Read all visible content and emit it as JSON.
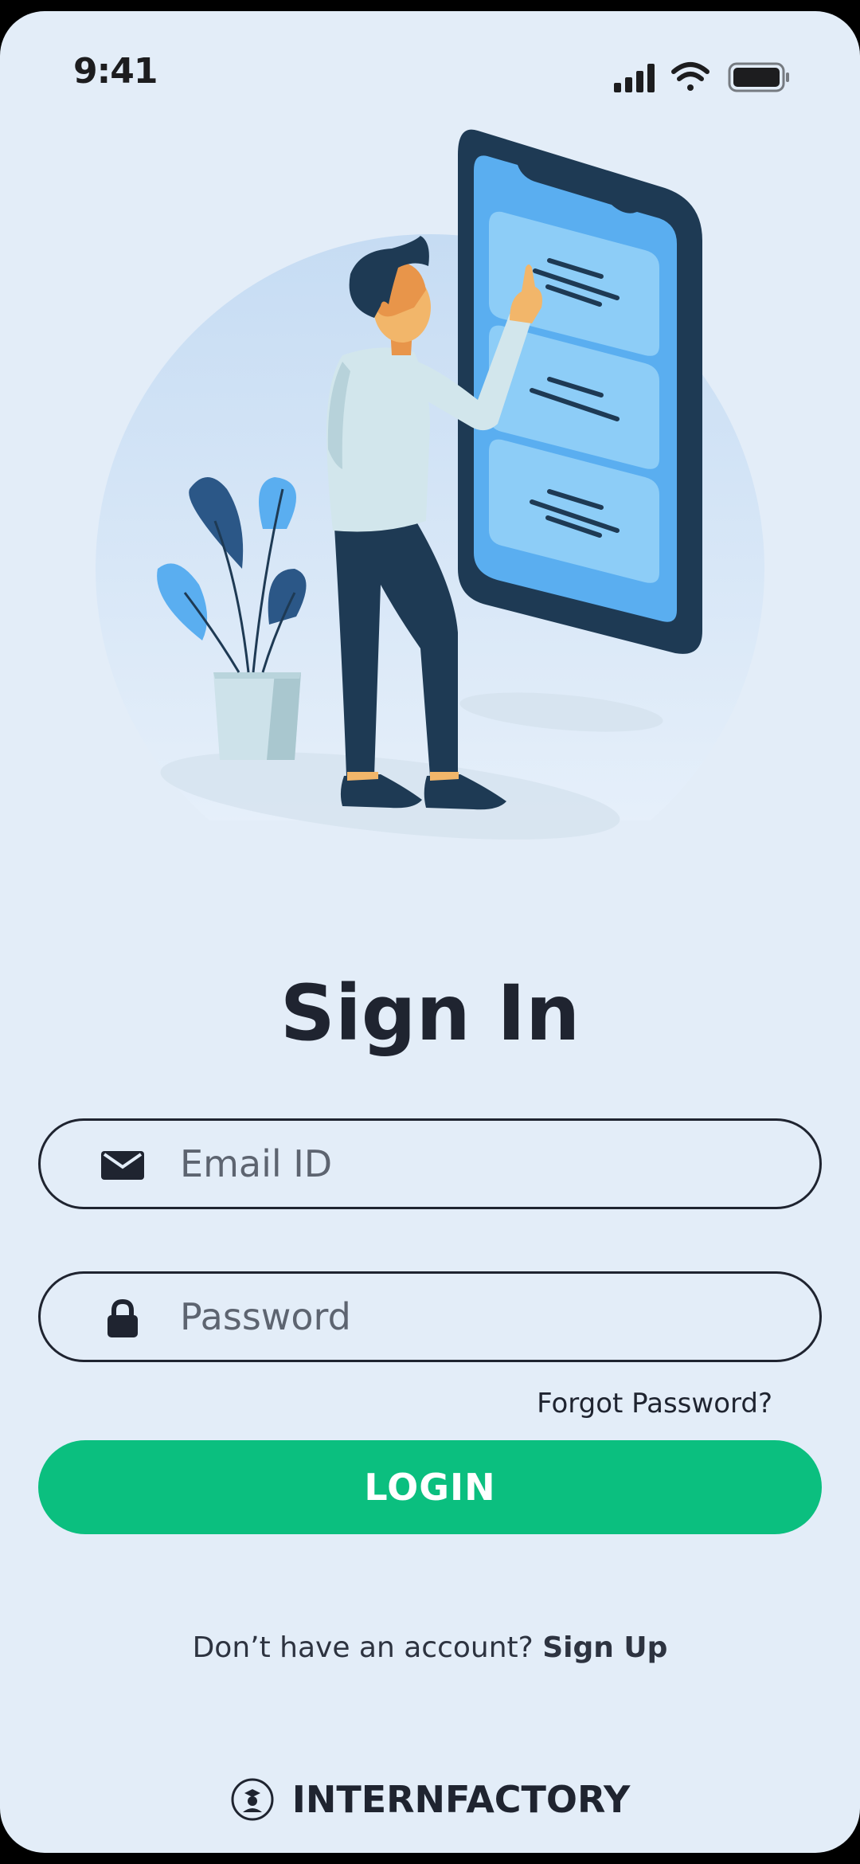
{
  "status_bar": {
    "time": "9:41",
    "icons": [
      "signal-icon",
      "wifi-icon",
      "battery-icon"
    ]
  },
  "illustration": {
    "name": "person-tapping-phone-illustration"
  },
  "page": {
    "title": "Sign In"
  },
  "form": {
    "email_placeholder": "Email ID",
    "password_placeholder": "Password",
    "forgot_label": "Forgot Password?",
    "login_label": "LOGIN"
  },
  "signup": {
    "prompt": "Don’t have an account?",
    "link": "Sign Up"
  },
  "brand": {
    "name": "INTERNFACTORY"
  },
  "colors": {
    "background": "#e3edf8",
    "primary_button": "#0bbf7f",
    "text": "#1f2430"
  }
}
